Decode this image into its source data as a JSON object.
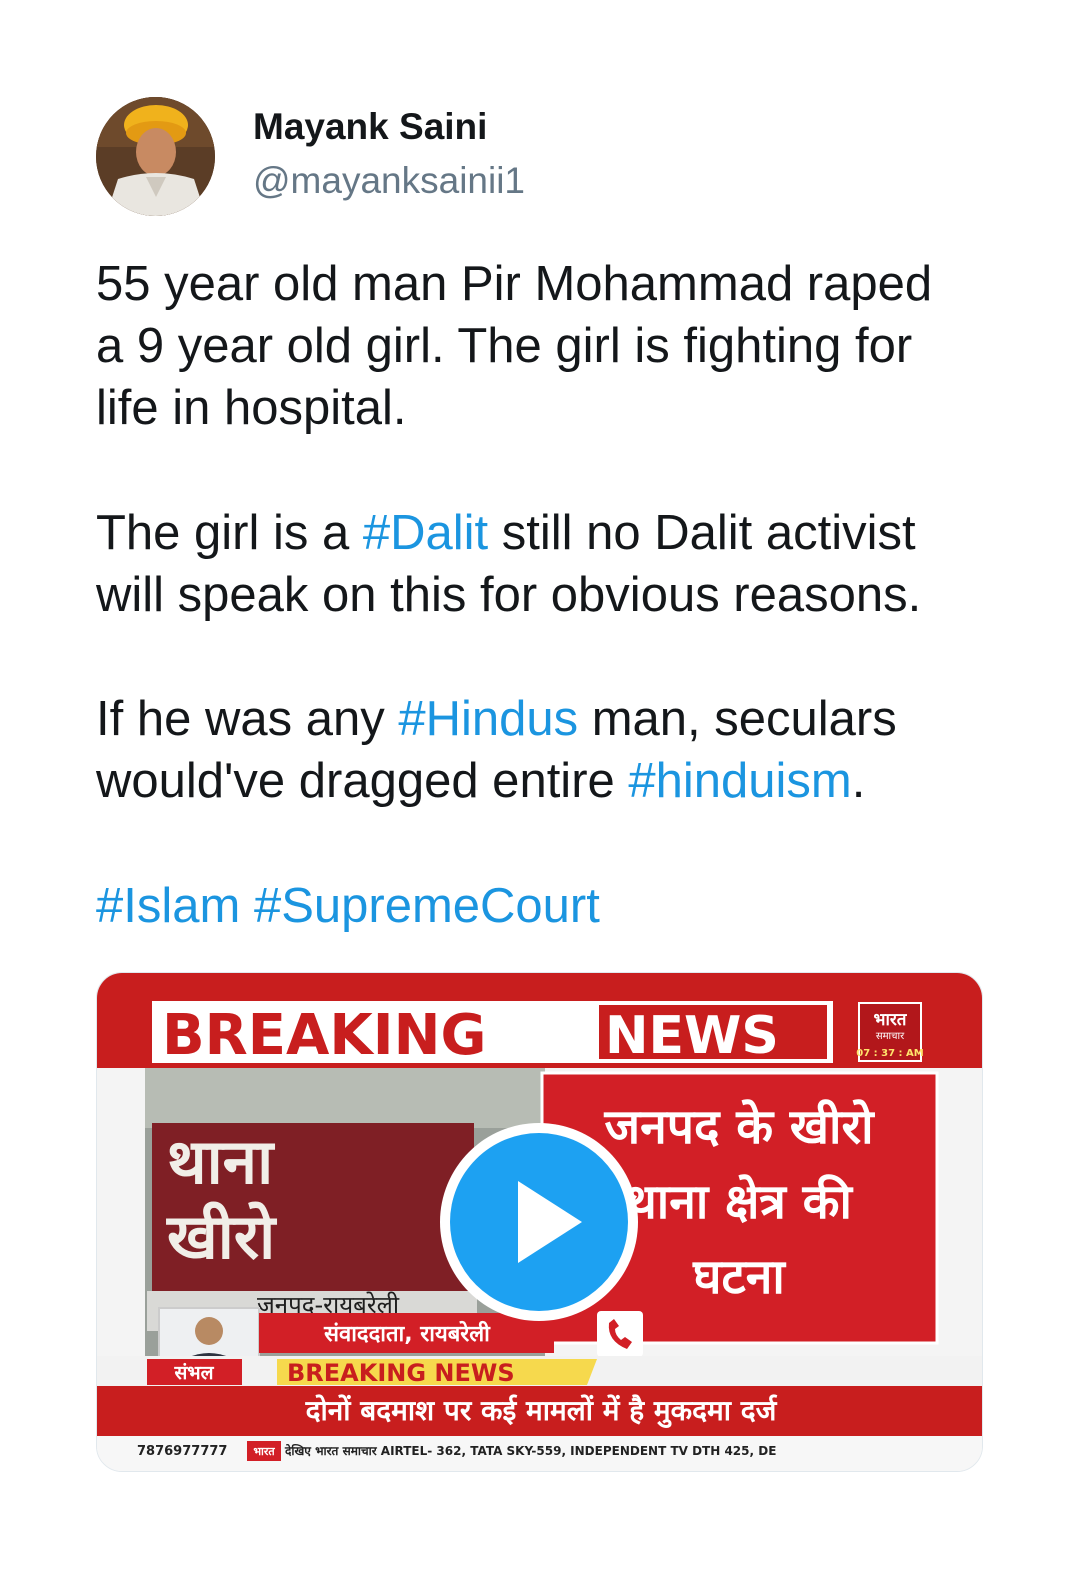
{
  "user": {
    "name": "Mayank Saini",
    "handle": "@mayanksainii1"
  },
  "tweet": {
    "p1_l1": "55 year old man Pir Mohammad raped",
    "p1_l2": "a 9 year old girl. The girl is fighting for",
    "p1_l3": "life in hospital.",
    "p2_l1_a": "The girl is a ",
    "p2_tag": "#Dalit",
    "p2_l1_b": " still no Dalit activist",
    "p2_l2": "will speak on this for obvious reasons.",
    "p3_l1_a": "If he was any ",
    "p3_tag1": "#Hindus",
    "p3_l1_b": " man, seculars",
    "p3_l2_a": "would've dragged entire ",
    "p3_tag2": "#hinduism",
    "p3_l2_b": ".",
    "tag_islam": "#Islam",
    "tag_court": "#SupremeCourt"
  },
  "video": {
    "breaking": "BREAKING",
    "news": "NEWS",
    "logo_top": "भारत",
    "logo_sub": "समाचार",
    "time": "07 : 37 : AM",
    "sign_line1": "थाना",
    "sign_line2": "खीरो",
    "sign_line3": "जनपद-रायबरेली",
    "headline_l1": "जनपद के खीरो",
    "headline_l2": "थाना क्षेत्र की",
    "headline_l3": "घटना",
    "reporter": "संवाददाता, रायबरेली",
    "location_tag": "संभल",
    "ticker_breaking": "BREAKING NEWS",
    "ticker_text": "दोनों बदमाश पर कई मामलों में है मुकदमा दर्ज",
    "bottom_phone": "7876977777",
    "bottom_text": "देखिए भारत समाचार AIRTEL- 362, TATA SKY-559, INDEPENDENT TV DTH 425, DE"
  },
  "colors": {
    "link": "#1b95e0",
    "play": "#1da1f2",
    "news_red": "#d21f26"
  },
  "icons": {
    "play": "play-icon",
    "phone": "phone-icon"
  }
}
